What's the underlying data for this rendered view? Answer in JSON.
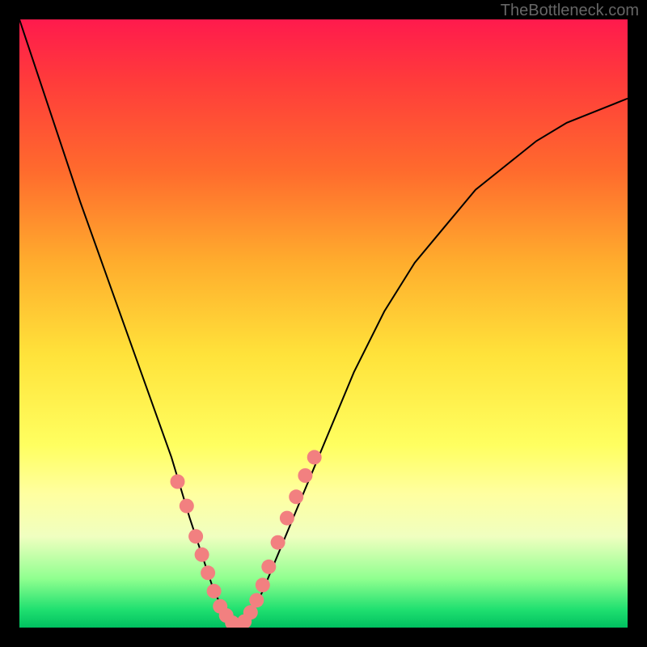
{
  "watermark": "TheBottleneck.com",
  "chart_data": {
    "type": "line",
    "title": "",
    "xlabel": "",
    "ylabel": "",
    "xlim": [
      0,
      100
    ],
    "ylim": [
      0,
      100
    ],
    "series": [
      {
        "name": "bottleneck-curve",
        "x": [
          0,
          5,
          10,
          15,
          20,
          25,
          28,
          30,
          32,
          34,
          36,
          38,
          40,
          45,
          50,
          55,
          60,
          65,
          70,
          75,
          80,
          85,
          90,
          95,
          100
        ],
        "y": [
          100,
          85,
          70,
          56,
          42,
          28,
          18,
          12,
          6,
          2,
          0,
          2,
          6,
          18,
          30,
          42,
          52,
          60,
          66,
          72,
          76,
          80,
          83,
          85,
          87
        ]
      }
    ],
    "markers": {
      "name": "highlight-points",
      "color": "#f28080",
      "points": [
        {
          "x": 26,
          "y": 24
        },
        {
          "x": 27.5,
          "y": 20
        },
        {
          "x": 29,
          "y": 15
        },
        {
          "x": 30,
          "y": 12
        },
        {
          "x": 31,
          "y": 9
        },
        {
          "x": 32,
          "y": 6
        },
        {
          "x": 33,
          "y": 3.5
        },
        {
          "x": 34,
          "y": 2
        },
        {
          "x": 35,
          "y": 0.8
        },
        {
          "x": 36,
          "y": 0.3
        },
        {
          "x": 37,
          "y": 1
        },
        {
          "x": 38,
          "y": 2.5
        },
        {
          "x": 39,
          "y": 4.5
        },
        {
          "x": 40,
          "y": 7
        },
        {
          "x": 41,
          "y": 10
        },
        {
          "x": 42.5,
          "y": 14
        },
        {
          "x": 44,
          "y": 18
        },
        {
          "x": 45.5,
          "y": 21.5
        },
        {
          "x": 47,
          "y": 25
        },
        {
          "x": 48.5,
          "y": 28
        }
      ]
    }
  }
}
